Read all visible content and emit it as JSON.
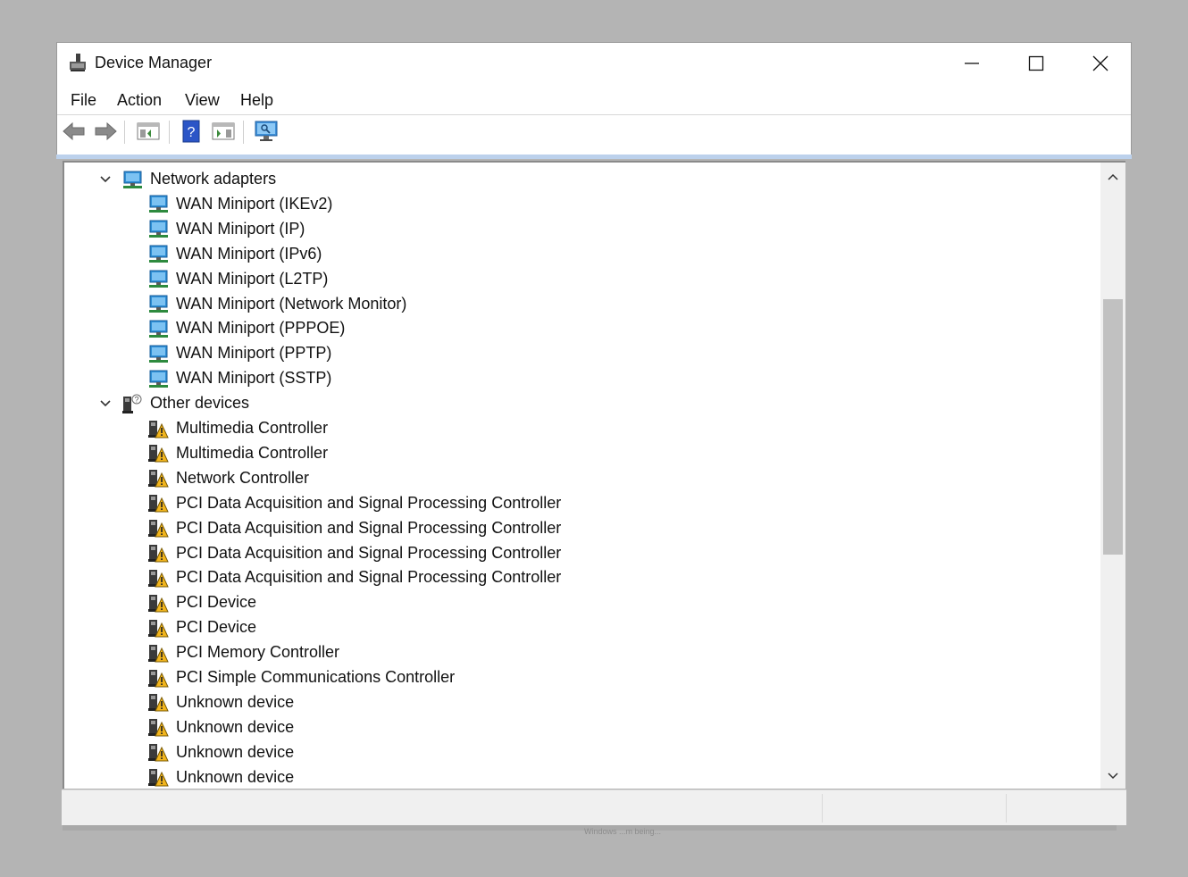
{
  "window": {
    "title": "Device Manager",
    "controls": [
      "minimize",
      "maximize",
      "close"
    ]
  },
  "menu": {
    "file": "File",
    "action": "Action",
    "view": "View",
    "help": "Help"
  },
  "toolbar": {
    "icons": [
      "back-icon",
      "forward-icon",
      "show-hide-console-tree-icon",
      "help-icon",
      "action-pane-icon",
      "monitor-icon"
    ]
  },
  "tree": {
    "network_adapters": {
      "label": "Network adapters",
      "items": [
        "WAN Miniport (IKEv2)",
        "WAN Miniport (IP)",
        "WAN Miniport (IPv6)",
        "WAN Miniport (L2TP)",
        "WAN Miniport (Network Monitor)",
        "WAN Miniport (PPPOE)",
        "WAN Miniport (PPTP)",
        "WAN Miniport (SSTP)"
      ]
    },
    "other_devices": {
      "label": "Other devices",
      "items": [
        "Multimedia Controller",
        "Multimedia Controller",
        "Network Controller",
        "PCI Data Acquisition and Signal Processing Controller",
        "PCI Data Acquisition and Signal Processing Controller",
        "PCI Data Acquisition and Signal Processing Controller",
        "PCI Data Acquisition and Signal Processing Controller",
        "PCI Device",
        "PCI Device",
        "PCI Memory Controller",
        "PCI Simple Communications Controller",
        "Unknown device",
        "Unknown device",
        "Unknown device",
        "Unknown device"
      ]
    }
  },
  "background_text": "Windows ...m being...",
  "colors": {
    "desktop": "#b4b4b4",
    "selection_bar": "#bcd1ec",
    "warning": "#f2b51d",
    "network_blue": "#2e8fd6"
  }
}
